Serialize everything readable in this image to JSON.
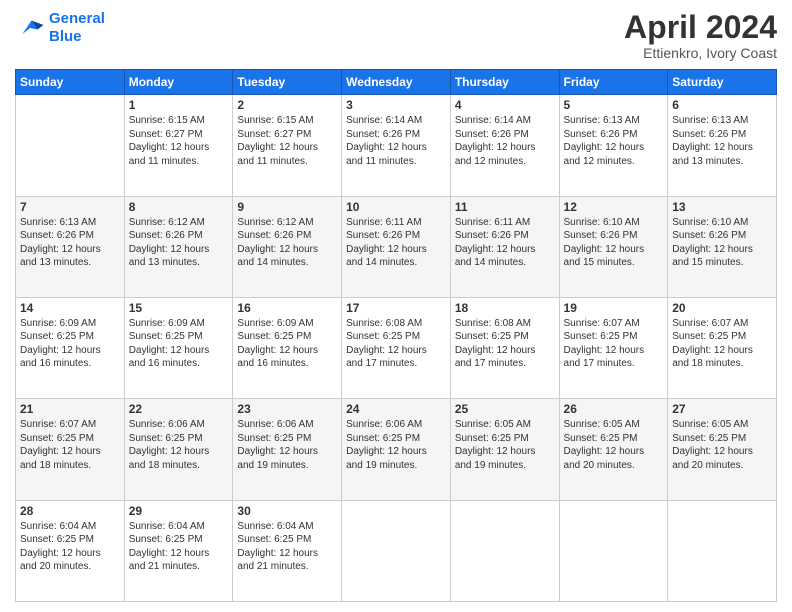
{
  "header": {
    "logo_line1": "General",
    "logo_line2": "Blue",
    "title": "April 2024",
    "subtitle": "Ettienkro, Ivory Coast"
  },
  "calendar": {
    "days_of_week": [
      "Sunday",
      "Monday",
      "Tuesday",
      "Wednesday",
      "Thursday",
      "Friday",
      "Saturday"
    ],
    "weeks": [
      [
        {
          "day": "",
          "info": ""
        },
        {
          "day": "1",
          "info": "Sunrise: 6:15 AM\nSunset: 6:27 PM\nDaylight: 12 hours\nand 11 minutes."
        },
        {
          "day": "2",
          "info": "Sunrise: 6:15 AM\nSunset: 6:27 PM\nDaylight: 12 hours\nand 11 minutes."
        },
        {
          "day": "3",
          "info": "Sunrise: 6:14 AM\nSunset: 6:26 PM\nDaylight: 12 hours\nand 11 minutes."
        },
        {
          "day": "4",
          "info": "Sunrise: 6:14 AM\nSunset: 6:26 PM\nDaylight: 12 hours\nand 12 minutes."
        },
        {
          "day": "5",
          "info": "Sunrise: 6:13 AM\nSunset: 6:26 PM\nDaylight: 12 hours\nand 12 minutes."
        },
        {
          "day": "6",
          "info": "Sunrise: 6:13 AM\nSunset: 6:26 PM\nDaylight: 12 hours\nand 13 minutes."
        }
      ],
      [
        {
          "day": "7",
          "info": "Sunrise: 6:13 AM\nSunset: 6:26 PM\nDaylight: 12 hours\nand 13 minutes."
        },
        {
          "day": "8",
          "info": "Sunrise: 6:12 AM\nSunset: 6:26 PM\nDaylight: 12 hours\nand 13 minutes."
        },
        {
          "day": "9",
          "info": "Sunrise: 6:12 AM\nSunset: 6:26 PM\nDaylight: 12 hours\nand 14 minutes."
        },
        {
          "day": "10",
          "info": "Sunrise: 6:11 AM\nSunset: 6:26 PM\nDaylight: 12 hours\nand 14 minutes."
        },
        {
          "day": "11",
          "info": "Sunrise: 6:11 AM\nSunset: 6:26 PM\nDaylight: 12 hours\nand 14 minutes."
        },
        {
          "day": "12",
          "info": "Sunrise: 6:10 AM\nSunset: 6:26 PM\nDaylight: 12 hours\nand 15 minutes."
        },
        {
          "day": "13",
          "info": "Sunrise: 6:10 AM\nSunset: 6:26 PM\nDaylight: 12 hours\nand 15 minutes."
        }
      ],
      [
        {
          "day": "14",
          "info": "Sunrise: 6:09 AM\nSunset: 6:25 PM\nDaylight: 12 hours\nand 16 minutes."
        },
        {
          "day": "15",
          "info": "Sunrise: 6:09 AM\nSunset: 6:25 PM\nDaylight: 12 hours\nand 16 minutes."
        },
        {
          "day": "16",
          "info": "Sunrise: 6:09 AM\nSunset: 6:25 PM\nDaylight: 12 hours\nand 16 minutes."
        },
        {
          "day": "17",
          "info": "Sunrise: 6:08 AM\nSunset: 6:25 PM\nDaylight: 12 hours\nand 17 minutes."
        },
        {
          "day": "18",
          "info": "Sunrise: 6:08 AM\nSunset: 6:25 PM\nDaylight: 12 hours\nand 17 minutes."
        },
        {
          "day": "19",
          "info": "Sunrise: 6:07 AM\nSunset: 6:25 PM\nDaylight: 12 hours\nand 17 minutes."
        },
        {
          "day": "20",
          "info": "Sunrise: 6:07 AM\nSunset: 6:25 PM\nDaylight: 12 hours\nand 18 minutes."
        }
      ],
      [
        {
          "day": "21",
          "info": "Sunrise: 6:07 AM\nSunset: 6:25 PM\nDaylight: 12 hours\nand 18 minutes."
        },
        {
          "day": "22",
          "info": "Sunrise: 6:06 AM\nSunset: 6:25 PM\nDaylight: 12 hours\nand 18 minutes."
        },
        {
          "day": "23",
          "info": "Sunrise: 6:06 AM\nSunset: 6:25 PM\nDaylight: 12 hours\nand 19 minutes."
        },
        {
          "day": "24",
          "info": "Sunrise: 6:06 AM\nSunset: 6:25 PM\nDaylight: 12 hours\nand 19 minutes."
        },
        {
          "day": "25",
          "info": "Sunrise: 6:05 AM\nSunset: 6:25 PM\nDaylight: 12 hours\nand 19 minutes."
        },
        {
          "day": "26",
          "info": "Sunrise: 6:05 AM\nSunset: 6:25 PM\nDaylight: 12 hours\nand 20 minutes."
        },
        {
          "day": "27",
          "info": "Sunrise: 6:05 AM\nSunset: 6:25 PM\nDaylight: 12 hours\nand 20 minutes."
        }
      ],
      [
        {
          "day": "28",
          "info": "Sunrise: 6:04 AM\nSunset: 6:25 PM\nDaylight: 12 hours\nand 20 minutes."
        },
        {
          "day": "29",
          "info": "Sunrise: 6:04 AM\nSunset: 6:25 PM\nDaylight: 12 hours\nand 21 minutes."
        },
        {
          "day": "30",
          "info": "Sunrise: 6:04 AM\nSunset: 6:25 PM\nDaylight: 12 hours\nand 21 minutes."
        },
        {
          "day": "",
          "info": ""
        },
        {
          "day": "",
          "info": ""
        },
        {
          "day": "",
          "info": ""
        },
        {
          "day": "",
          "info": ""
        }
      ]
    ]
  }
}
